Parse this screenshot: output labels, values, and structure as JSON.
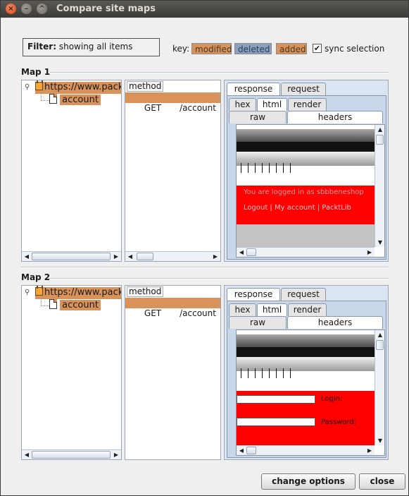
{
  "window": {
    "title": "Compare site maps"
  },
  "filter": {
    "label": "Filter:",
    "value": "showing all items"
  },
  "key": {
    "label": "key:",
    "items": [
      {
        "label": "modified",
        "color": "#d8925a"
      },
      {
        "label": "deleted",
        "color": "#8aa0bf"
      },
      {
        "label": "added",
        "color": "#d8925a"
      }
    ]
  },
  "sync": {
    "label": "sync selection",
    "checked": true,
    "checkmark": "✔"
  },
  "maps": [
    {
      "label": "Map 1",
      "tree": {
        "host": "https://www.packt",
        "child": "account"
      },
      "list": {
        "header": "method",
        "rows": [
          {
            "method": "GET",
            "path": "/account"
          }
        ]
      },
      "viewer": {
        "tabs_top": [
          "response",
          "request"
        ],
        "tabs_mid": [
          "hex",
          "html",
          "render"
        ],
        "tabs_bot": [
          "raw",
          "headers"
        ],
        "page_text": [
          "You are logged in as sbbbeneshop",
          "Logout  |  My account  |  PacktLib"
        ]
      }
    },
    {
      "label": "Map 2",
      "tree": {
        "host": "https://www.packt",
        "child": "account"
      },
      "list": {
        "header": "method",
        "rows": [
          {
            "method": "GET",
            "path": "/account"
          }
        ]
      },
      "viewer": {
        "tabs_top": [
          "response",
          "request"
        ],
        "tabs_mid": [
          "hex",
          "html",
          "render"
        ],
        "tabs_bot": [
          "raw",
          "headers"
        ],
        "login_labels": [
          "Login:",
          "Password:"
        ]
      }
    }
  ],
  "buttons": {
    "change_options": "change options",
    "close": "close"
  },
  "icons": {
    "close": "close-icon",
    "minimize": "minimize-icon",
    "maximize": "maximize-icon",
    "lock": "lock-icon",
    "document": "document-icon",
    "expander": "expander-icon"
  }
}
